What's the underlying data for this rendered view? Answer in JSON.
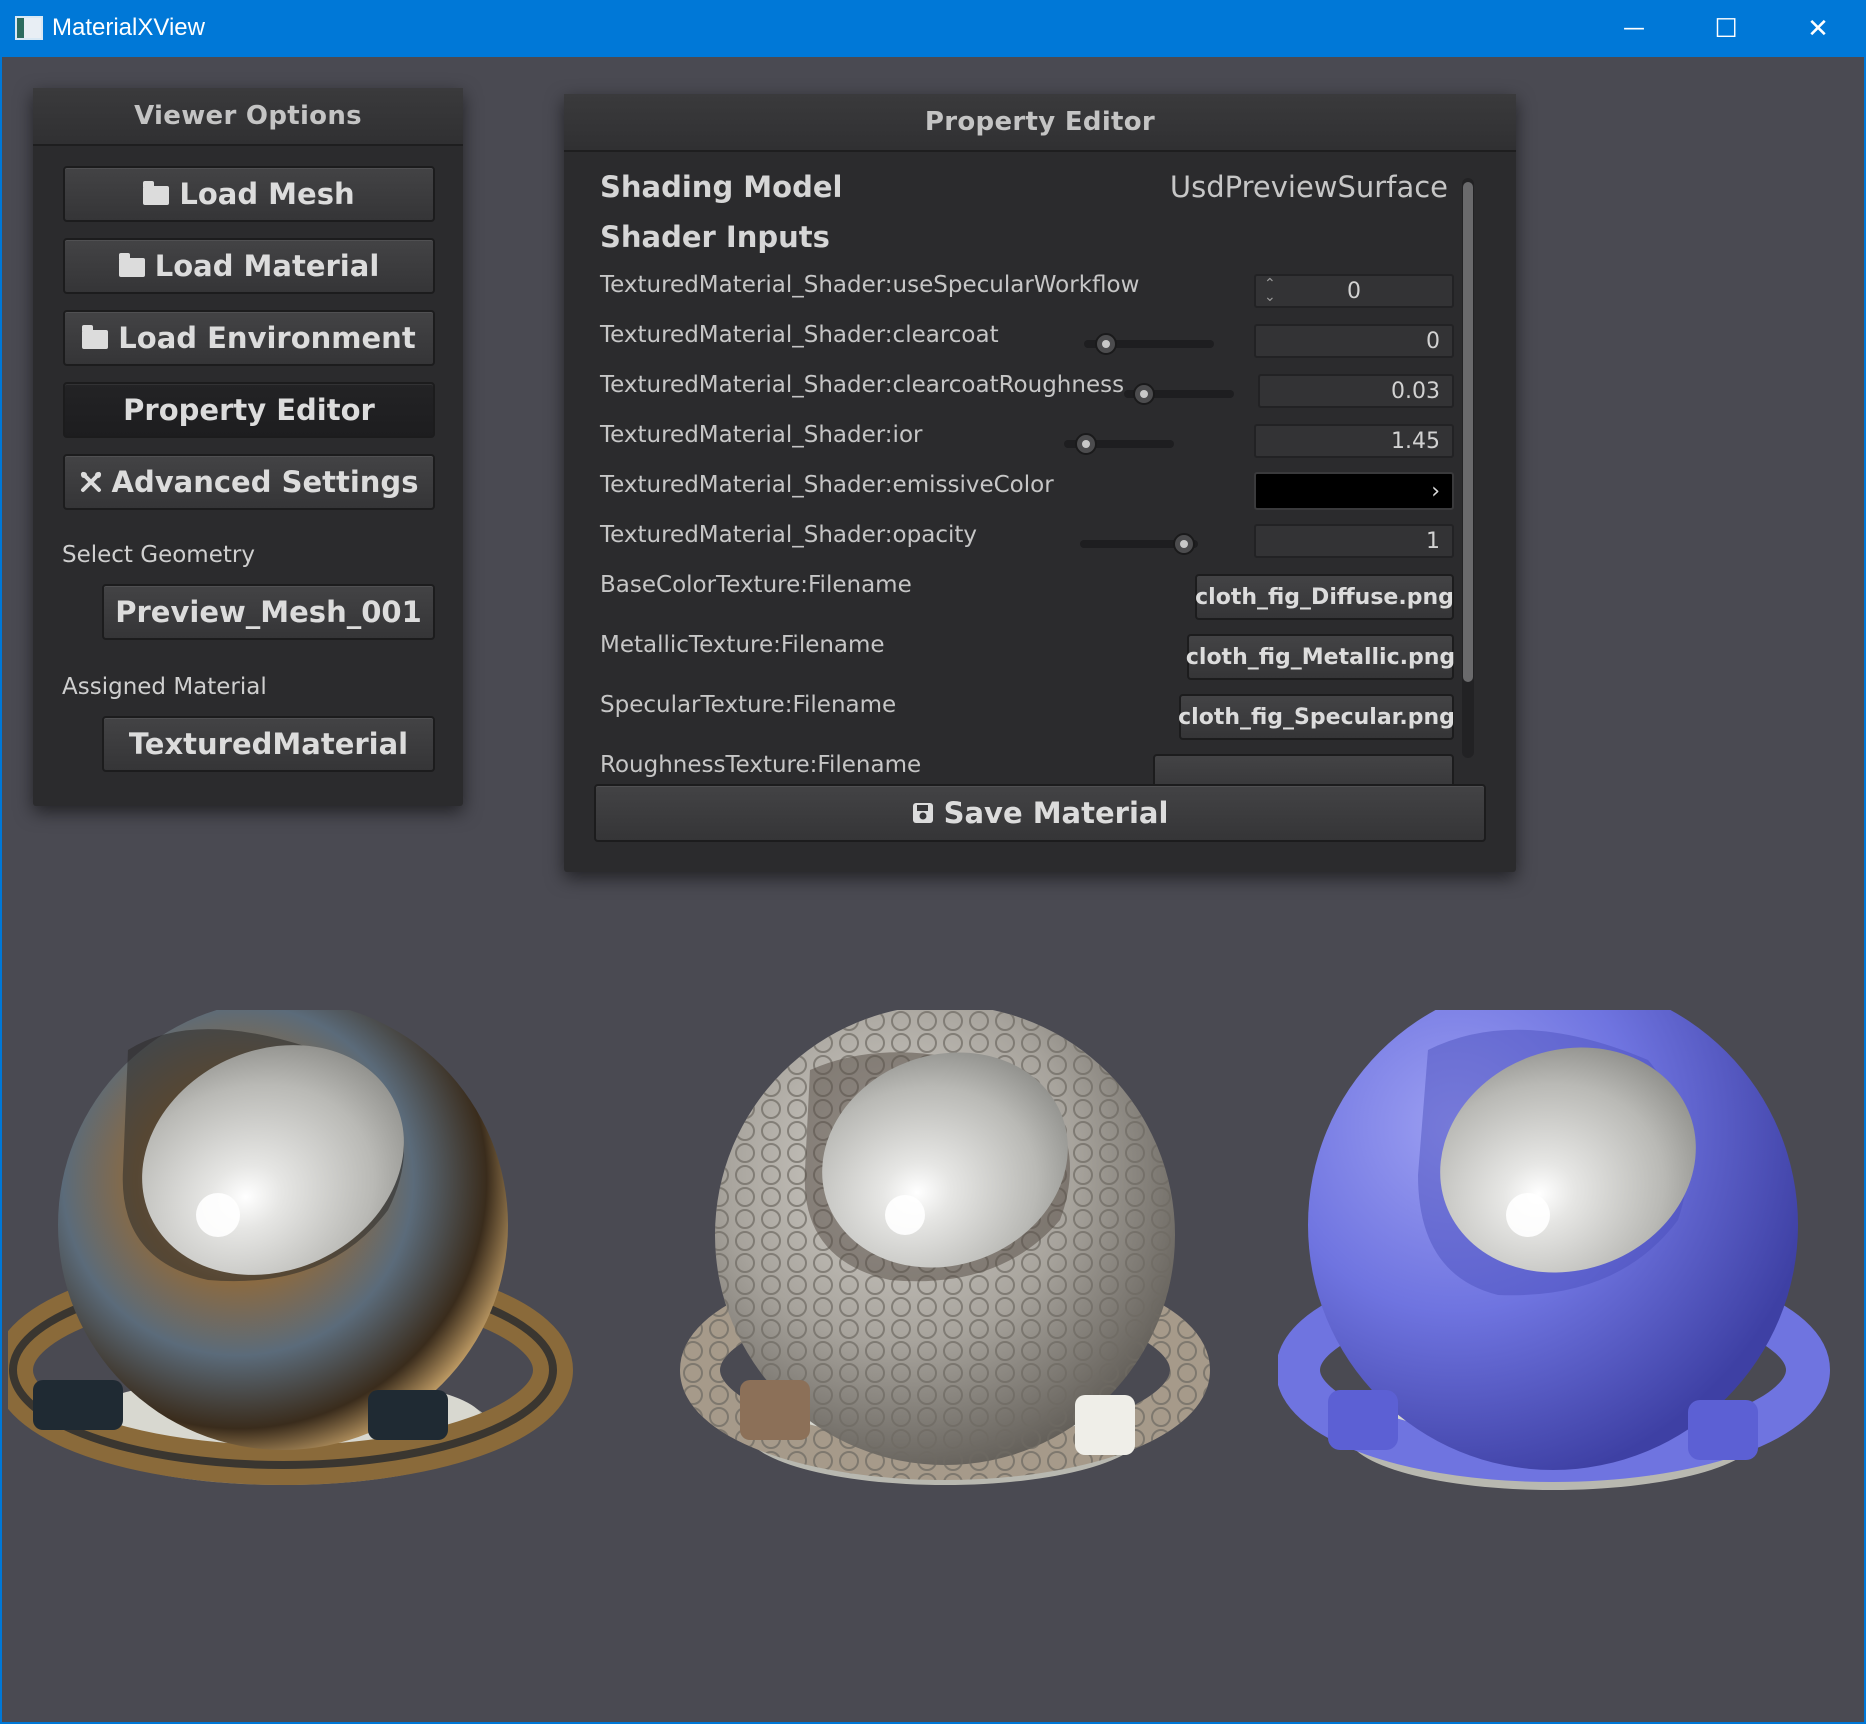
{
  "window": {
    "title": "MaterialXView",
    "minimize_glyph": "—",
    "maximize_glyph": "☐",
    "close_glyph": "✕"
  },
  "viewer_options": {
    "title": "Viewer Options",
    "buttons": [
      {
        "label": "Load Mesh",
        "icon": "folder-icon"
      },
      {
        "label": "Load Material",
        "icon": "folder-icon"
      },
      {
        "label": "Load Environment",
        "icon": "folder-icon"
      },
      {
        "label": "Property Editor",
        "icon": ""
      },
      {
        "label": "Advanced Settings",
        "icon": "tools-icon"
      }
    ],
    "select_geometry_label": "Select Geometry",
    "geometry_value": "Preview_Mesh_001",
    "assigned_material_label": "Assigned Material",
    "material_value": "TexturedMaterial"
  },
  "property_editor": {
    "title": "Property Editor",
    "shading_model_label": "Shading Model",
    "shading_model_value": "UsdPreviewSurface",
    "shader_inputs_label": "Shader Inputs",
    "inputs": [
      {
        "label": "TexturedMaterial_Shader:useSpecularWorkflow",
        "value": "0",
        "kind": "int"
      },
      {
        "label": "TexturedMaterial_Shader:clearcoat",
        "value": "0",
        "kind": "float",
        "slider": 0.0
      },
      {
        "label": "TexturedMaterial_Shader:clearcoatRoughness",
        "value": "0.03",
        "kind": "float",
        "slider": 0.03
      },
      {
        "label": "TexturedMaterial_Shader:ior",
        "value": "1.45",
        "kind": "float",
        "slider": 0.24
      },
      {
        "label": "TexturedMaterial_Shader:emissiveColor",
        "value": "#000000",
        "kind": "color",
        "expand_glyph": "›"
      },
      {
        "label": "TexturedMaterial_Shader:opacity",
        "value": "1",
        "kind": "float",
        "slider": 1.0
      },
      {
        "label": "BaseColorTexture:Filename",
        "value": "cloth_fig_Diffuse.png",
        "kind": "file"
      },
      {
        "label": "MetallicTexture:Filename",
        "value": "cloth_fig_Metallic.png",
        "kind": "file"
      },
      {
        "label": "SpecularTexture:Filename",
        "value": "cloth_fig_Specular.png",
        "kind": "file"
      },
      {
        "label": "RoughnessTexture:Filename",
        "value": "",
        "kind": "file"
      }
    ],
    "save_label": "Save Material"
  },
  "colors": {
    "titlebar": "#0078d7",
    "background": "#4a4a52",
    "panel": "#2b2b2d",
    "purple_material": "#6f74e0"
  }
}
